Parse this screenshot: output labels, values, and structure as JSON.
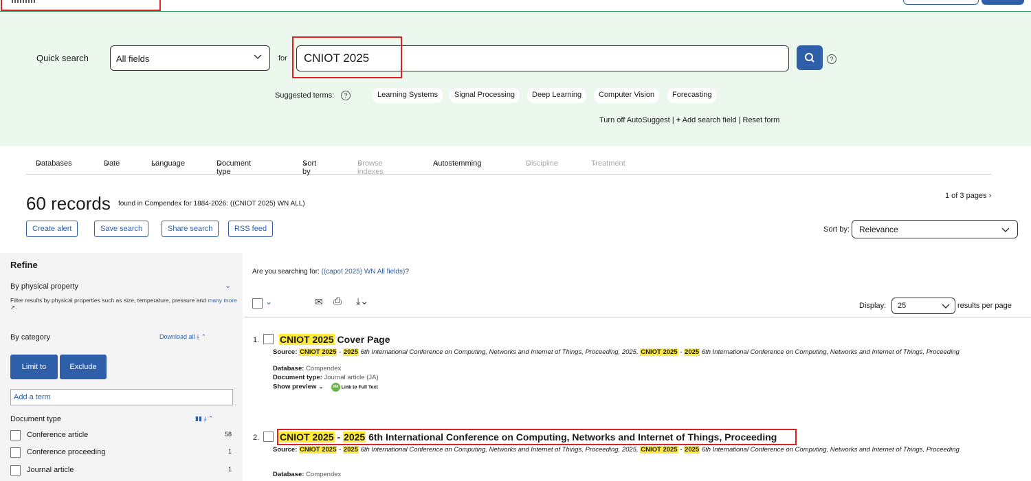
{
  "search": {
    "quick_search_label": "Quick search",
    "field_selected": "All fields",
    "for_label": "for",
    "query": "CNIOT 2025",
    "suggested_label": "Suggested terms:",
    "suggested_terms": [
      "Learning Systems",
      "Signal Processing",
      "Deep Learning",
      "Computer Vision",
      "Forecasting"
    ],
    "turn_off": "Turn off AutoSuggest",
    "add_field": "Add search field",
    "reset": "Reset form",
    "help": "?"
  },
  "filters": [
    {
      "label": "Databases",
      "enabled": true
    },
    {
      "label": "Date",
      "enabled": true
    },
    {
      "label": "Language",
      "enabled": true
    },
    {
      "label": "Document type",
      "enabled": true
    },
    {
      "label": "Sort by",
      "enabled": true
    },
    {
      "label": "Browse indexes",
      "enabled": false
    },
    {
      "label": "Autostemming",
      "enabled": true
    },
    {
      "label": "Discipline",
      "enabled": false
    },
    {
      "label": "Treatment",
      "enabled": false
    }
  ],
  "records": {
    "count": "60 records",
    "description": "found in Compendex for 1884-2026: ((CNIOT 2025) WN ALL)",
    "pages": "1 of 3 pages",
    "actions": [
      "Create alert",
      "Save search",
      "Share search",
      "RSS feed"
    ],
    "sort_label": "Sort by:",
    "sort_value": "Relevance"
  },
  "refine": {
    "title": "Refine",
    "physical_title": "By physical property",
    "physical_desc": "Filter results by physical properties such as size, temperature, pressure and",
    "many_more": "many more",
    "category_title": "By category",
    "download_all": "Download all",
    "limit": "Limit to",
    "exclude": "Exclude",
    "term_placeholder": "Add a term",
    "doctype_title": "Document type",
    "facets": [
      {
        "label": "Conference article",
        "count": "58"
      },
      {
        "label": "Conference proceeding",
        "count": "1"
      },
      {
        "label": "Journal article",
        "count": "1"
      }
    ]
  },
  "results": {
    "searching_prefix": "Are you searching for:",
    "searching_link": "((capot 2025) WN All fields)",
    "display_label": "Display:",
    "display_value": "25",
    "per_page": "results per page",
    "items": [
      {
        "num": "1.",
        "title_hl": "CNIOT 2025",
        "title_rest": " Cover Page",
        "source": "6th International Conference on Computing, Networks and Internet of Things, Proceeding, 2025,",
        "source_tail": "6th International Conference on Computing, Networks and Internet of Things, Proceeding",
        "database": "Compendex",
        "doctype": "Journal article (JA)",
        "preview": "Show preview",
        "fulltext": "Link to Full Text"
      },
      {
        "num": "2.",
        "title_hl": "CNIOT 2025",
        "title_hl2": "2025",
        "title_rest": " 6th International Conference on Computing, Networks and Internet of Things, Proceeding",
        "source": "6th International Conference on Computing, Networks and Internet of Things, Proceeding, 2025,",
        "source_tail": "6th International Conference on Computing, Networks and Internet of Things, Proceeding",
        "database": "Compendex"
      }
    ]
  },
  "labels": {
    "source": "Source:",
    "database": "Database:",
    "doctype": "Document type:",
    "cniot": "CNIOT",
    "year": "2025",
    "dash": "-"
  },
  "colors": {
    "accent": "#2e5fa8",
    "highlight": "#ffea3a",
    "band": "#ecf7ee",
    "annotation": "#e02020"
  }
}
